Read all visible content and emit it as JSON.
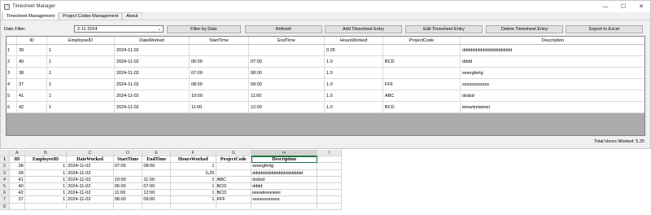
{
  "window": {
    "title": "Timesheet Manager",
    "controls": [
      "—",
      "☐",
      "✕"
    ]
  },
  "tabs": [
    {
      "label": "Timesheet Management",
      "active": true
    },
    {
      "label": "Project Codes Management",
      "active": false
    },
    {
      "label": "About",
      "active": false
    }
  ],
  "toolbar": {
    "filter_label": "Date Filter:",
    "filter_value": "2-11-2024",
    "filter_by_date": "Filter by Date",
    "refresh": "Refresh",
    "add": "Add Timesheet Entry",
    "edit": "Edit Timesheet Entry",
    "delete": "Delete Timesheet Entry",
    "export": "Export to Excel"
  },
  "grid": {
    "columns": [
      "ID",
      "EmployeeID",
      "DateWorked",
      "StartTime",
      "EndTime",
      "HoursWorked",
      "ProjectCode",
      "Description"
    ],
    "rows": [
      {
        "num": "1",
        "cells": [
          "39",
          "1",
          "2024-11-02",
          "",
          "",
          "0.25",
          "",
          "dddddddddddddddddddd"
        ]
      },
      {
        "num": "2",
        "cells": [
          "40",
          "1",
          "2024-11-02",
          "06:00",
          "07:00",
          "1.0",
          "BCD",
          "dddd"
        ]
      },
      {
        "num": "3",
        "cells": [
          "38",
          "1",
          "2024-11-02",
          "07:00",
          "08:00",
          "1.0",
          "",
          "sewrgfertg"
        ]
      },
      {
        "num": "4",
        "cells": [
          "37",
          "1",
          "2024-11-02",
          "08:00",
          "09:00",
          "1.0",
          "FFF",
          "ssssssssssss"
        ]
      },
      {
        "num": "5",
        "cells": [
          "41",
          "1",
          "2024-11-02",
          "10:00",
          "11:00",
          "1.0",
          "ABC",
          "dxdsd"
        ]
      },
      {
        "num": "6",
        "cells": [
          "42",
          "1",
          "2024-11-02",
          "11:00",
          "12:00",
          "1.0",
          "BCD",
          "ieiewiireieieiei"
        ]
      }
    ]
  },
  "total": "Total Hours Worked: 5.25",
  "sheet": {
    "col_letters": [
      "A",
      "B",
      "C",
      "D",
      "E",
      "F",
      "G",
      "H",
      "I"
    ],
    "row_numbers": [
      "1",
      "2",
      "3",
      "4",
      "5",
      "6",
      "7",
      "8"
    ],
    "header": [
      "ID",
      "EmployeeID",
      "DateWorked",
      "StartTime",
      "EndTime",
      "HoursWorked",
      "ProjectCode",
      "Description",
      ""
    ],
    "rows": [
      [
        "38",
        "1",
        "2024-11-02",
        "07:00",
        "08:00",
        "1",
        "",
        "sewrgfertg",
        ""
      ],
      [
        "39",
        "1",
        "2024-11-02",
        "",
        "",
        "0,25",
        "",
        "dddddddddddddddddddd",
        ""
      ],
      [
        "41",
        "1",
        "2024-11-02",
        "10:00",
        "11:00",
        "1",
        "ABC",
        "dxdsd",
        ""
      ],
      [
        "40",
        "1",
        "2024-11-02",
        "06:00",
        "07:00",
        "1",
        "BCD",
        "dddd",
        ""
      ],
      [
        "42",
        "1",
        "2024-11-02",
        "11:00",
        "12:00",
        "1",
        "BCD",
        "ieiewiireieieiei",
        ""
      ],
      [
        "37",
        "1",
        "2024-11-02",
        "08:00",
        "09:00",
        "1",
        "FFF",
        "ssssssssssss",
        ""
      ],
      [
        "",
        "",
        "",
        "",
        "",
        "",
        "",
        "",
        ""
      ]
    ]
  }
}
